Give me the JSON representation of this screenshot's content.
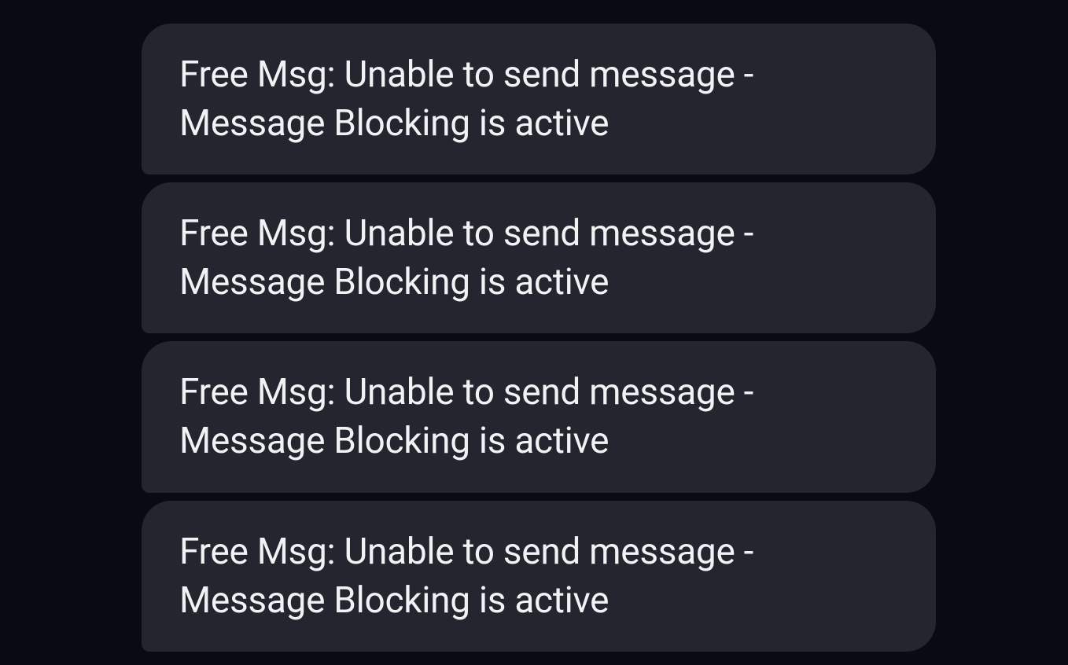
{
  "messages": [
    {
      "text": "Free Msg: Unable to send message - Message Blocking is active"
    },
    {
      "text": "Free Msg: Unable to send message - Message Blocking is active"
    },
    {
      "text": "Free Msg: Unable to send message - Message Blocking is active"
    },
    {
      "text": "Free Msg: Unable to send message - Message Blocking is active"
    }
  ]
}
